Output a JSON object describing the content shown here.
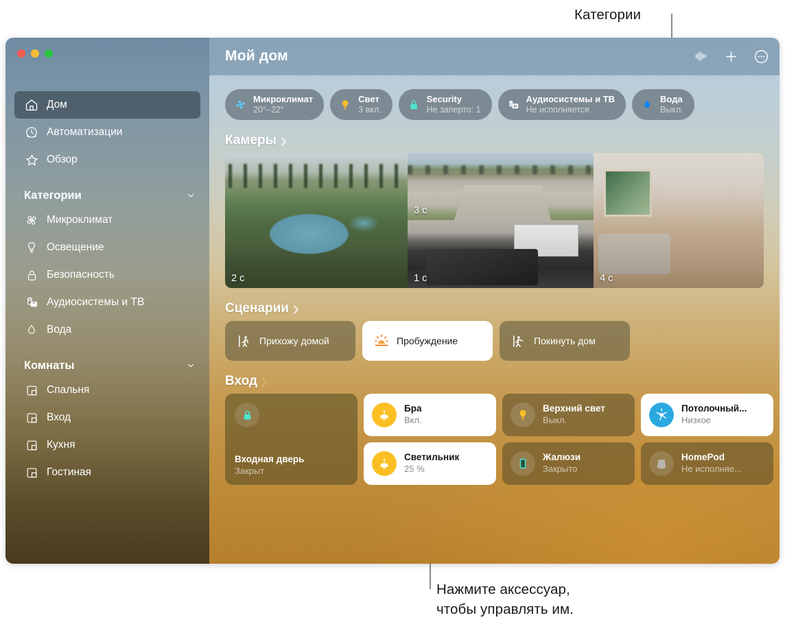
{
  "annotations": {
    "top": "Категории",
    "bottom_line1": "Нажмите аксессуар,",
    "bottom_line2": "чтобы управлять им."
  },
  "window": {
    "title": "Мой дом"
  },
  "toolbar": {
    "buttons": [
      {
        "name": "audio-waveform",
        "icon": "waveform-icon"
      },
      {
        "name": "add",
        "icon": "plus-icon"
      },
      {
        "name": "more",
        "icon": "ellipsis-circle-icon"
      }
    ]
  },
  "sidebar": {
    "primary": [
      {
        "label": "Дом",
        "icon": "house-icon",
        "selected": true
      },
      {
        "label": "Автоматизации",
        "icon": "clock-icon",
        "selected": false
      },
      {
        "label": "Обзор",
        "icon": "star-icon",
        "selected": false
      }
    ],
    "categories_header": "Категории",
    "categories": [
      {
        "label": "Микроклимат",
        "icon": "fan-icon"
      },
      {
        "label": "Освещение",
        "icon": "bulb-icon"
      },
      {
        "label": "Безопасность",
        "icon": "lock-icon"
      },
      {
        "label": "Аудиосистемы и ТВ",
        "icon": "speaker-tv-icon"
      },
      {
        "label": "Вода",
        "icon": "droplet-icon"
      }
    ],
    "rooms_header": "Комнаты",
    "rooms": [
      {
        "label": "Спальня",
        "icon": "room-icon"
      },
      {
        "label": "Вход",
        "icon": "room-icon"
      },
      {
        "label": "Кухня",
        "icon": "room-icon"
      },
      {
        "label": "Гостиная",
        "icon": "room-icon"
      }
    ]
  },
  "status_pills": [
    {
      "name": "Микроклимат",
      "value": "20°–22°",
      "icon": "fan-icon",
      "color": "#5ac8f5"
    },
    {
      "name": "Свет",
      "value": "3 вкл.",
      "icon": "bulb-icon",
      "color": "#fbbf24"
    },
    {
      "name": "Security",
      "value": "Не заперто: 1",
      "icon": "lock-icon",
      "color": "#4fe3d0"
    },
    {
      "name": "Аудиосистемы и ТВ",
      "value": "Не исполняется",
      "icon": "speaker-tv-icon",
      "color": "#e9e9e9"
    },
    {
      "name": "Вода",
      "value": "Выкл.",
      "icon": "droplet-icon",
      "color": "#0a84ff"
    }
  ],
  "sections": {
    "cameras_title": "Камеры",
    "scenes_title": "Сценарии",
    "room_title": "Вход"
  },
  "cameras": [
    {
      "caption": "2 с",
      "scene": "pool"
    },
    {
      "caption": "3 с",
      "scene": "driveway"
    },
    {
      "caption": "1 с",
      "scene": "garage"
    },
    {
      "caption": "4 с",
      "scene": "living-room"
    }
  ],
  "scenes": [
    {
      "label": "Прихожу домой",
      "icon": "walk-in-icon",
      "active": false
    },
    {
      "label": "Пробуждение",
      "icon": "sunrise-icon",
      "active": true
    },
    {
      "label": "Покинуть дом",
      "icon": "walk-out-icon",
      "active": false
    }
  ],
  "accessories": [
    {
      "name": "Входная дверь",
      "value": "Закрыт",
      "icon": "lock-icon",
      "style": "tall"
    },
    {
      "name": "Бра",
      "value": "Вкл.",
      "icon": "lamp-icon",
      "style": "white"
    },
    {
      "name": "Верхний свет",
      "value": "Выкл.",
      "icon": "bulb-icon",
      "style": "dim"
    },
    {
      "name": "Потолочный...",
      "value": "Низкое",
      "icon": "ceiling-fan-icon",
      "style": "white"
    },
    {
      "name": "Светильник",
      "value": "25 %",
      "icon": "lamp-icon",
      "style": "white"
    },
    {
      "name": "Жалюзи",
      "value": "Закрыто",
      "icon": "blinds-icon",
      "style": "dim"
    },
    {
      "name": "HomePod",
      "value": "Не исполняе...",
      "icon": "homepod-icon",
      "style": "dim"
    }
  ]
}
